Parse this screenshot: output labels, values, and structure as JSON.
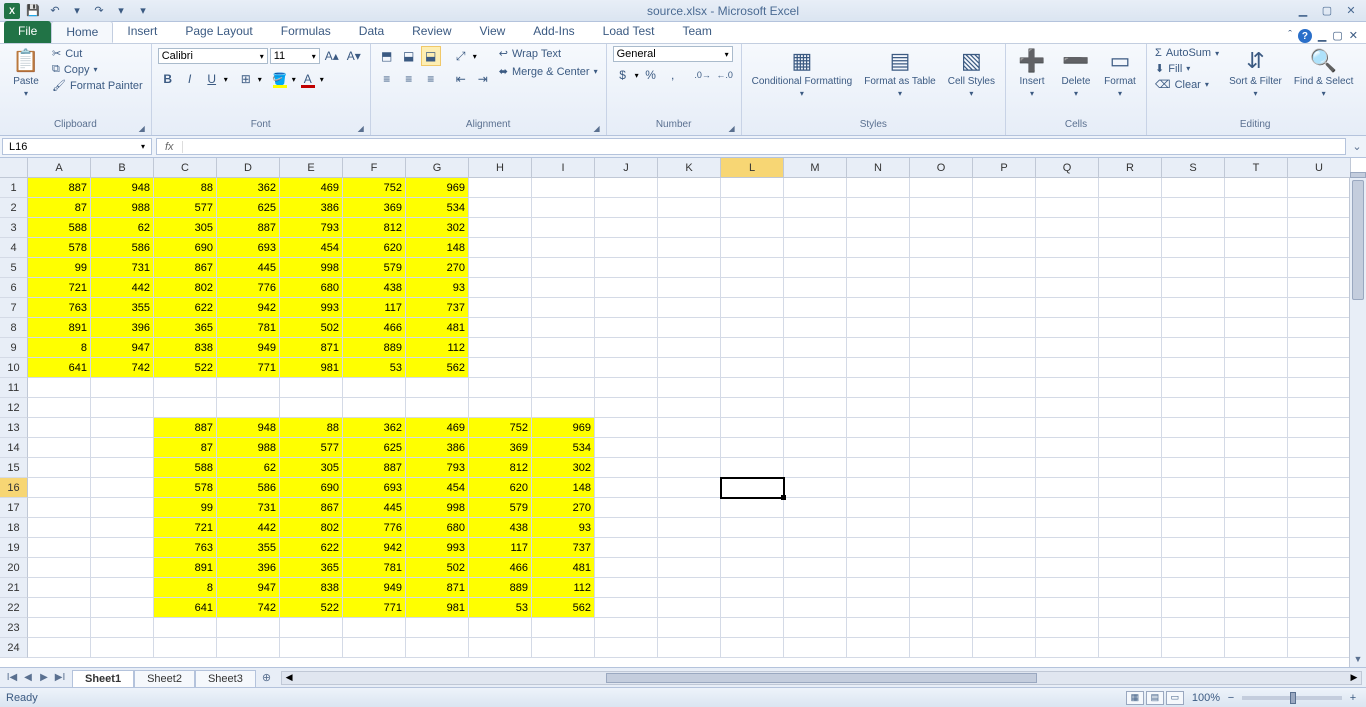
{
  "app": {
    "title": "source.xlsx - Microsoft Excel"
  },
  "qat": {
    "save": "💾",
    "undo": "↶",
    "redo": "↷",
    "dd": "▾"
  },
  "tabs": [
    "File",
    "Home",
    "Insert",
    "Page Layout",
    "Formulas",
    "Data",
    "Review",
    "View",
    "Add-Ins",
    "Load Test",
    "Team"
  ],
  "active_tab": "Home",
  "ribbon": {
    "clipboard": {
      "label": "Clipboard",
      "paste": "Paste",
      "cut": "Cut",
      "copy": "Copy",
      "fmtpainter": "Format Painter"
    },
    "font": {
      "label": "Font",
      "name": "Calibri",
      "size": "11",
      "bold": "B",
      "italic": "I",
      "underline": "U"
    },
    "alignment": {
      "label": "Alignment",
      "wrap": "Wrap Text",
      "merge": "Merge & Center"
    },
    "number": {
      "label": "Number",
      "format": "General"
    },
    "styles": {
      "label": "Styles",
      "cond": "Conditional Formatting",
      "table": "Format as Table",
      "cellst": "Cell Styles"
    },
    "cells": {
      "label": "Cells",
      "insert": "Insert",
      "delete": "Delete",
      "format": "Format"
    },
    "editing": {
      "label": "Editing",
      "autosum": "AutoSum",
      "fill": "Fill",
      "clear": "Clear",
      "sort": "Sort & Filter",
      "find": "Find & Select"
    }
  },
  "namebox": "L16",
  "formula": "",
  "columns": [
    "A",
    "B",
    "C",
    "D",
    "E",
    "F",
    "G",
    "H",
    "I",
    "J",
    "K",
    "L",
    "M",
    "N",
    "O",
    "P",
    "Q",
    "R",
    "S",
    "T",
    "U"
  ],
  "rows": 24,
  "active_cell": {
    "row": 16,
    "col": "L"
  },
  "highlight_col": "L",
  "highlight_row": 16,
  "data_block1": {
    "rows_start": 1,
    "cols_start": "A",
    "values": [
      [
        887,
        948,
        88,
        362,
        469,
        752,
        969
      ],
      [
        87,
        988,
        577,
        625,
        386,
        369,
        534
      ],
      [
        588,
        62,
        305,
        887,
        793,
        812,
        302
      ],
      [
        578,
        586,
        690,
        693,
        454,
        620,
        148
      ],
      [
        99,
        731,
        867,
        445,
        998,
        579,
        270
      ],
      [
        721,
        442,
        802,
        776,
        680,
        438,
        93
      ],
      [
        763,
        355,
        622,
        942,
        993,
        117,
        737
      ],
      [
        891,
        396,
        365,
        781,
        502,
        466,
        481
      ],
      [
        8,
        947,
        838,
        949,
        871,
        889,
        112
      ],
      [
        641,
        742,
        522,
        771,
        981,
        53,
        562
      ]
    ]
  },
  "data_block2": {
    "rows_start": 13,
    "cols_start": "C",
    "values": [
      [
        887,
        948,
        88,
        362,
        469,
        752,
        969
      ],
      [
        87,
        988,
        577,
        625,
        386,
        369,
        534
      ],
      [
        588,
        62,
        305,
        887,
        793,
        812,
        302
      ],
      [
        578,
        586,
        690,
        693,
        454,
        620,
        148
      ],
      [
        99,
        731,
        867,
        445,
        998,
        579,
        270
      ],
      [
        721,
        442,
        802,
        776,
        680,
        438,
        93
      ],
      [
        763,
        355,
        622,
        942,
        993,
        117,
        737
      ],
      [
        891,
        396,
        365,
        781,
        502,
        466,
        481
      ],
      [
        8,
        947,
        838,
        949,
        871,
        889,
        112
      ],
      [
        641,
        742,
        522,
        771,
        981,
        53,
        562
      ]
    ]
  },
  "sheets": [
    "Sheet1",
    "Sheet2",
    "Sheet3"
  ],
  "active_sheet": "Sheet1",
  "status": {
    "ready": "Ready",
    "zoom": "100%"
  }
}
